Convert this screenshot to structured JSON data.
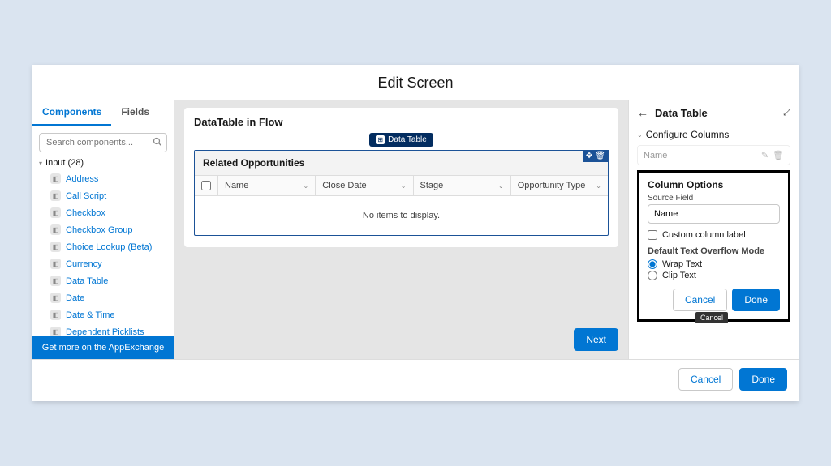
{
  "page_title": "Edit Screen",
  "tabs": {
    "components": "Components",
    "fields": "Fields"
  },
  "search": {
    "placeholder": "Search components..."
  },
  "input_group": {
    "header": "Input (28)",
    "items": [
      "Address",
      "Call Script",
      "Checkbox",
      "Checkbox Group",
      "Choice Lookup (Beta)",
      "Currency",
      "Data Table",
      "Date",
      "Date & Time",
      "Dependent Picklists"
    ]
  },
  "appexchange": "Get more on the AppExchange",
  "canvas": {
    "title": "DataTable in Flow",
    "chip": "Data Table",
    "dt_title": "Related Opportunities",
    "columns": [
      "Name",
      "Close Date",
      "Stage",
      "Opportunity Type"
    ],
    "empty": "No items to display.",
    "next": "Next"
  },
  "right": {
    "title": "Data Table",
    "section": "Configure Columns",
    "col_name": "Name",
    "options": {
      "title": "Column Options",
      "source_label": "Source Field",
      "source_value": "Name",
      "custom_label": "Custom column label",
      "overflow_label": "Default Text Overflow Mode",
      "wrap": "Wrap Text",
      "clip": "Clip Text",
      "cancel": "Cancel",
      "done": "Done",
      "tooltip": "Cancel"
    }
  },
  "footer": {
    "cancel": "Cancel",
    "done": "Done"
  }
}
